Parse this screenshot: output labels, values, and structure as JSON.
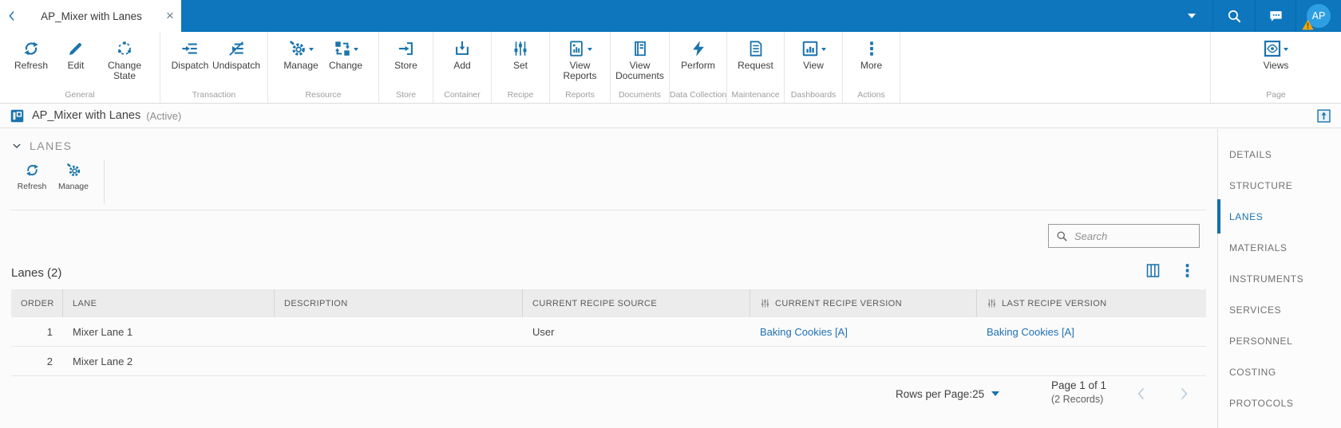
{
  "colors": {
    "top_bar_blue": "#0d76bd",
    "accent_blue": "#1b74ad",
    "link_blue": "#2071b5",
    "active_nav_blue": "#1a74ad",
    "warning_orange": "#eda70f",
    "avatar_blue": "#2f9fe3",
    "table_header_bg": "#ececec"
  },
  "tab_bar": {
    "tab_title": "AP_Mixer with Lanes",
    "avatar_initials": "AP"
  },
  "ribbon": {
    "groups": [
      {
        "label": "General",
        "buttons": [
          {
            "label": "Refresh"
          },
          {
            "label": "Edit"
          },
          {
            "label": "Change State"
          }
        ]
      },
      {
        "label": "Transaction",
        "buttons": [
          {
            "label": "Dispatch"
          },
          {
            "label": "Undispatch"
          }
        ]
      },
      {
        "label": "Resource",
        "buttons": [
          {
            "label": "Manage",
            "has_dropdown": true
          },
          {
            "label": "Change",
            "has_dropdown": true
          }
        ]
      },
      {
        "label": "Store",
        "buttons": [
          {
            "label": "Store"
          }
        ]
      },
      {
        "label": "Container",
        "buttons": [
          {
            "label": "Add"
          }
        ]
      },
      {
        "label": "Recipe",
        "buttons": [
          {
            "label": "Set"
          }
        ]
      },
      {
        "label": "Reports",
        "buttons": [
          {
            "label": "View Reports",
            "has_dropdown": true
          }
        ]
      },
      {
        "label": "Documents",
        "buttons": [
          {
            "label": "View Documents"
          }
        ]
      },
      {
        "label": "Data Collection",
        "buttons": [
          {
            "label": "Perform"
          }
        ]
      },
      {
        "label": "Maintenance",
        "buttons": [
          {
            "label": "Request"
          }
        ]
      },
      {
        "label": "Dashboards",
        "buttons": [
          {
            "label": "View",
            "has_dropdown": true
          }
        ]
      },
      {
        "label": "Actions",
        "buttons": [
          {
            "label": "More"
          }
        ]
      },
      {
        "label": "Page",
        "buttons": [
          {
            "label": "Views",
            "has_dropdown": true
          }
        ]
      }
    ]
  },
  "title_bar": {
    "title": "AP_Mixer with Lanes",
    "status": "(Active)"
  },
  "lanes_section": {
    "header": "LANES",
    "toolbar": [
      {
        "label": "Refresh"
      },
      {
        "label": "Manage"
      }
    ],
    "search_placeholder": "Search"
  },
  "table": {
    "title": "Lanes (2)",
    "columns": [
      "ORDER",
      "LANE",
      "DESCRIPTION",
      "CURRENT RECIPE SOURCE",
      "CURRENT RECIPE VERSION",
      "LAST RECIPE VERSION"
    ],
    "rows": [
      {
        "order": "1",
        "lane": "Mixer Lane 1",
        "description": "",
        "current_recipe_source": "User",
        "current_recipe_version": "Baking Cookies [A]",
        "last_recipe_version": "Baking Cookies [A]"
      },
      {
        "order": "2",
        "lane": "Mixer Lane 2",
        "description": "",
        "current_recipe_source": "",
        "current_recipe_version": "",
        "last_recipe_version": ""
      }
    ]
  },
  "pagination": {
    "rows_per_page_label": "Rows per Page:",
    "rows_per_page_value": "25",
    "page_info": "Page 1 of 1",
    "records_info": "(2 Records)"
  },
  "sidebar": {
    "items": [
      {
        "label": "DETAILS"
      },
      {
        "label": "STRUCTURE"
      },
      {
        "label": "LANES",
        "active": true
      },
      {
        "label": "MATERIALS"
      },
      {
        "label": "INSTRUMENTS"
      },
      {
        "label": "SERVICES"
      },
      {
        "label": "PERSONNEL"
      },
      {
        "label": "COSTING"
      },
      {
        "label": "PROTOCOLS"
      }
    ]
  }
}
